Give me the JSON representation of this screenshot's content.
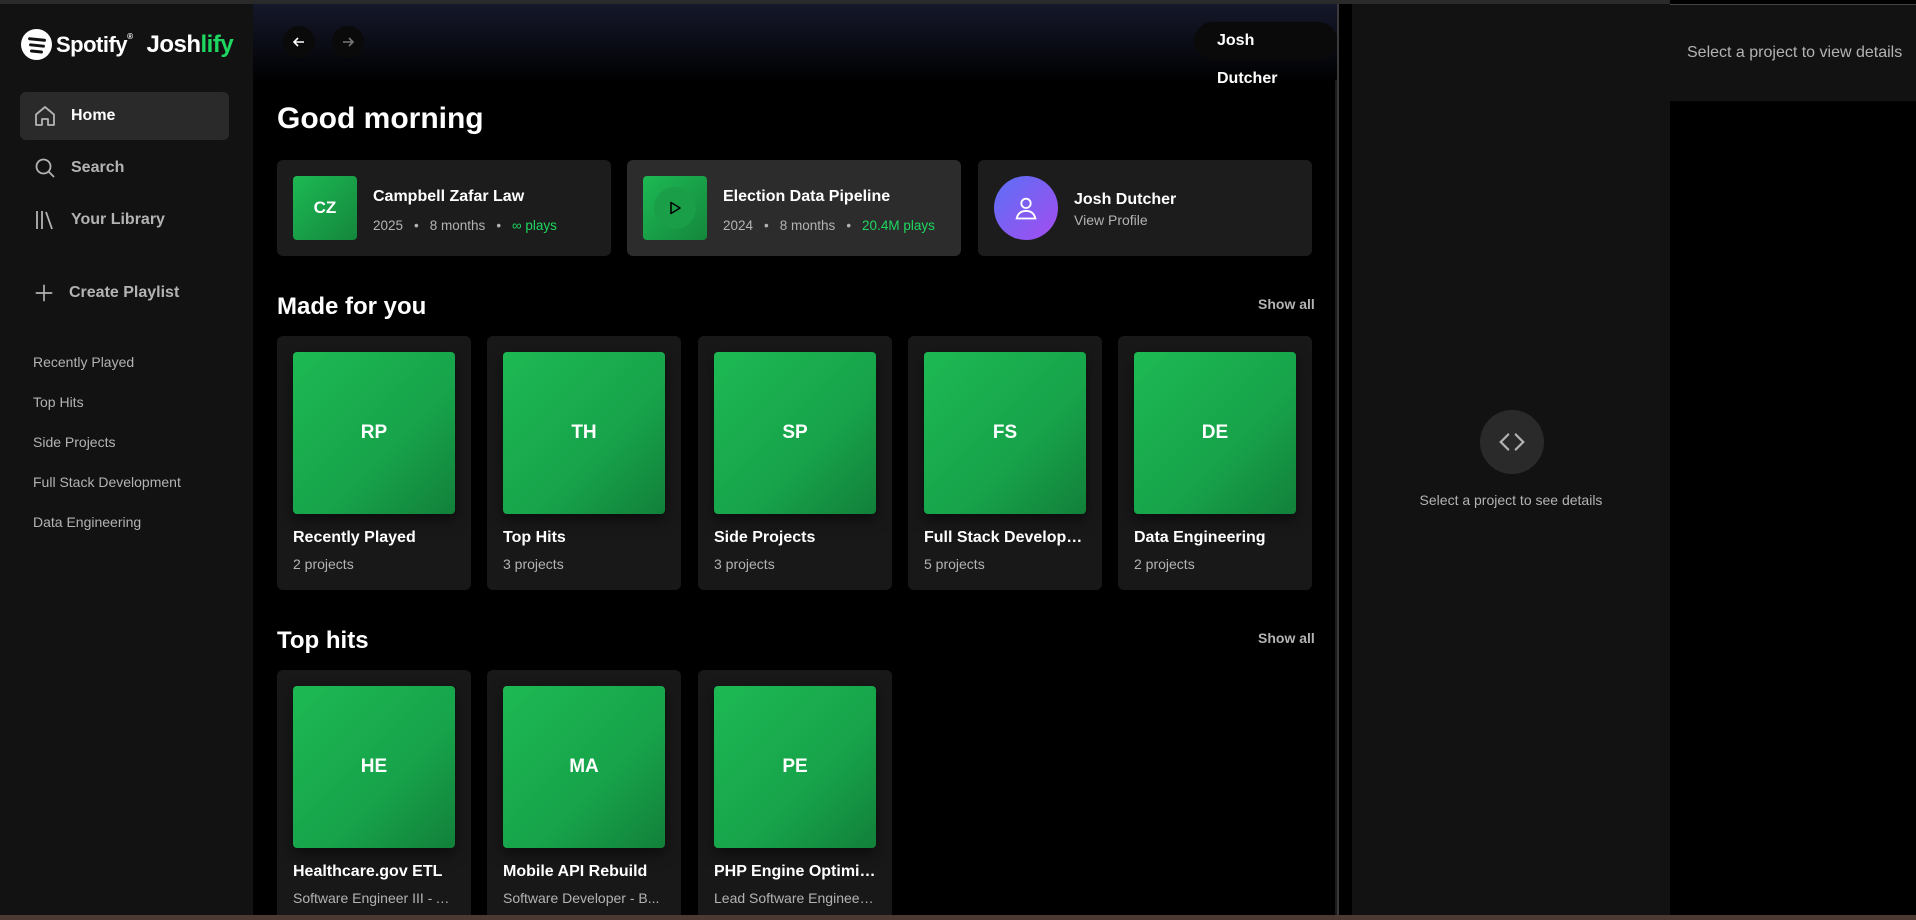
{
  "brand": {
    "spotify": "Spotify",
    "josh_prefix": "Josh",
    "josh_suffix": "lify"
  },
  "nav": {
    "home": "Home",
    "search": "Search",
    "library": "Your Library",
    "create": "Create Playlist"
  },
  "playlists": [
    "Recently Played",
    "Top Hits",
    "Side Projects",
    "Full Stack Development",
    "Data Engineering"
  ],
  "header": {
    "user": "Josh Dutcher"
  },
  "greeting": "Good morning",
  "quick": [
    {
      "art": "CZ",
      "title": "Campbell Zafar Law",
      "year": "2025",
      "duration": "8 months",
      "plays": "∞ plays"
    },
    {
      "art": "",
      "title": "Election Data Pipeline",
      "year": "2024",
      "duration": "8 months",
      "plays": "20.4M plays"
    }
  ],
  "profile": {
    "name": "Josh Dutcher",
    "sub": "View Profile"
  },
  "made_for_you": {
    "title": "Made for you",
    "show_all": "Show all",
    "cards": [
      {
        "art": "RP",
        "title": "Recently Played",
        "sub": "2 projects"
      },
      {
        "art": "TH",
        "title": "Top Hits",
        "sub": "3 projects"
      },
      {
        "art": "SP",
        "title": "Side Projects",
        "sub": "3 projects"
      },
      {
        "art": "FS",
        "title": "Full Stack Development",
        "sub": "5 projects"
      },
      {
        "art": "DE",
        "title": "Data Engineering",
        "sub": "2 projects"
      }
    ]
  },
  "top_hits": {
    "title": "Top hits",
    "show_all": "Show all",
    "cards": [
      {
        "art": "HE",
        "title": "Healthcare.gov ETL",
        "sub": "Software Engineer III - A..."
      },
      {
        "art": "MA",
        "title": "Mobile API Rebuild",
        "sub": "Software Developer - B..."
      },
      {
        "art": "PE",
        "title": "PHP Engine Optimiz...",
        "sub": "Lead Software Engineer ..."
      }
    ]
  },
  "detail": {
    "placeholder": "Select a project to see details"
  },
  "overlay": {
    "text": "Select a project to view details"
  },
  "colors": {
    "accent": "#1ed760",
    "sidebar": "#121212",
    "card": "#181818"
  }
}
